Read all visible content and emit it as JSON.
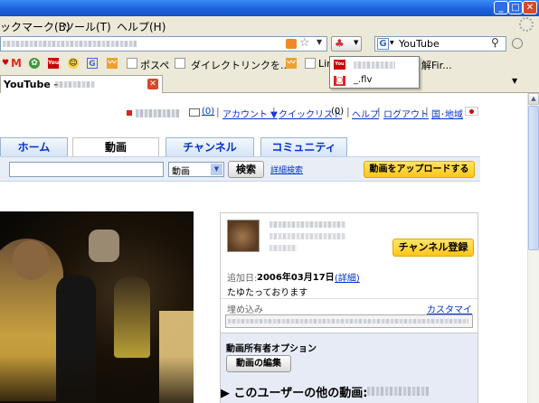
{
  "browser": {
    "title_text": "ックマーク(B)",
    "menu": [
      "ックマーク(B)",
      "ツール(T)",
      "ヘルプ(H)"
    ],
    "search_engine_icon": "google-icon",
    "search_value": "YouTube",
    "bookmarks": [
      "ポスペ",
      "ダイレクトリンクを...",
      "Lir",
      "解Fir..."
    ],
    "tab_title": "YouTube -",
    "dropdown_items": [
      "",
      "_.flv"
    ]
  },
  "header": {
    "mail_count": "(0)",
    "account": "アカウント ▼",
    "quicklist": "クイックリスト",
    "quicklist_count": "(0)",
    "help": "ヘルプ",
    "logout": "ログアウト",
    "region": "国･地域"
  },
  "nav_tabs": [
    "ホーム",
    "動画",
    "チャンネル",
    "コミュニティ"
  ],
  "search": {
    "category": "動画",
    "button": "検索",
    "advanced": "詳細検索",
    "upload": "動画をアップロードする"
  },
  "info": {
    "subscribe": "チャンネル登録",
    "added_label": "追加日:",
    "added_date": "2006年03月17日",
    "details": "(詳細)",
    "description": "たゆたっております",
    "embed_label": "埋め込み",
    "customize": "カスタマイズ",
    "owner_options": "動画所有者オプション",
    "edit_button": "動画の編集"
  },
  "more_videos": "▶ このユーザーの他の動画:",
  "colors": {
    "xp_blue": "#1a5fd8",
    "link_blue": "#0033cc",
    "upload_yellow": "#ffc61a"
  }
}
